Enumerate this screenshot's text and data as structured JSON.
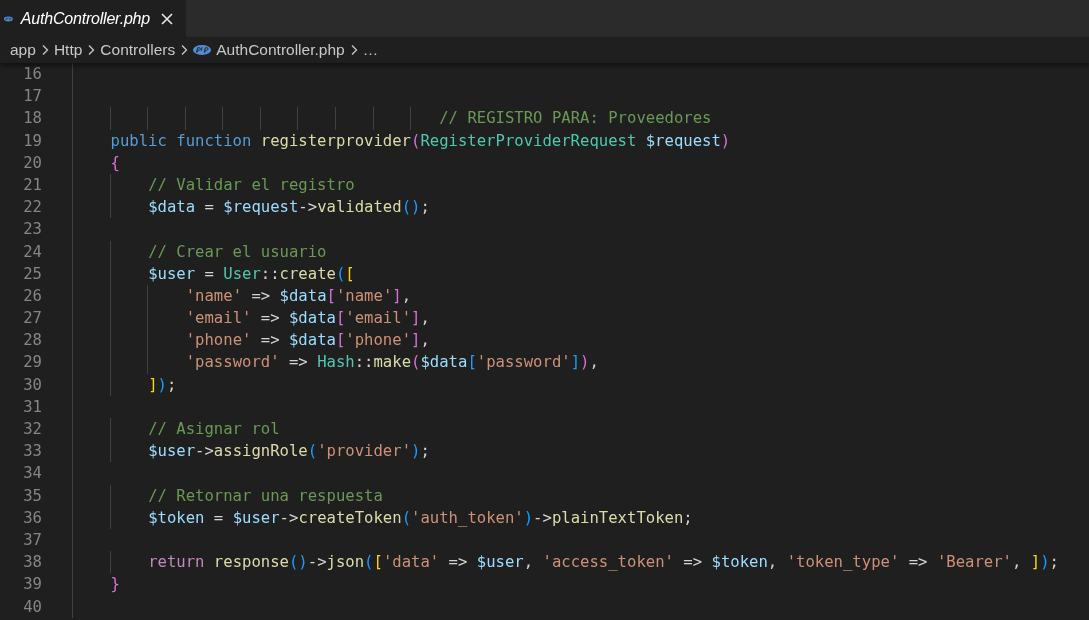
{
  "tab": {
    "label": "AuthController.php",
    "selected": true,
    "preview": true
  },
  "breadcrumb": [
    "app",
    "Http",
    "Controllers",
    "AuthController.php",
    "…"
  ],
  "lines": [
    {
      "number": "16"
    },
    {
      "number": "17"
    },
    {
      "number": "18",
      "tokens": [
        {
          "kind": "cmt",
          "text": "                                       // REGISTRO PARA: Proveedores"
        }
      ]
    },
    {
      "number": "19",
      "tokens": [
        {
          "kind": "kw",
          "text": "    public"
        },
        {
          "kind": "kw",
          "text": " function"
        },
        {
          "kind": "fn",
          "text": " registerprovider"
        },
        {
          "kind": "b2",
          "text": "("
        },
        {
          "kind": "cls",
          "text": "RegisterProviderRequest"
        },
        {
          "kind": "var",
          "text": " $request"
        },
        {
          "kind": "b2",
          "text": ")"
        }
      ]
    },
    {
      "number": "20",
      "tokens": [
        {
          "kind": "b2",
          "text": "    {"
        }
      ]
    },
    {
      "number": "21",
      "tokens": [
        {
          "kind": "cmt",
          "text": "        // Validar el registro"
        }
      ]
    },
    {
      "number": "22",
      "tokens": [
        {
          "kind": "var",
          "text": "        $data"
        },
        {
          "kind": "op",
          "text": " = "
        },
        {
          "kind": "var",
          "text": "$request"
        },
        {
          "kind": "op",
          "text": "->"
        },
        {
          "kind": "fn",
          "text": "validated"
        },
        {
          "kind": "b3",
          "text": "()"
        },
        {
          "kind": "op",
          "text": ";"
        }
      ]
    },
    {
      "number": "23"
    },
    {
      "number": "24",
      "tokens": [
        {
          "kind": "cmt",
          "text": "        // Crear el usuario"
        }
      ]
    },
    {
      "number": "25",
      "tokens": [
        {
          "kind": "var",
          "text": "        $user"
        },
        {
          "kind": "op",
          "text": " = "
        },
        {
          "kind": "cls",
          "text": "User"
        },
        {
          "kind": "op",
          "text": "::"
        },
        {
          "kind": "fn",
          "text": "create"
        },
        {
          "kind": "b3",
          "text": "("
        },
        {
          "kind": "b1",
          "text": "["
        }
      ]
    },
    {
      "number": "26",
      "tokens": [
        {
          "kind": "str",
          "text": "            'name'"
        },
        {
          "kind": "op",
          "text": " => "
        },
        {
          "kind": "var",
          "text": "$data"
        },
        {
          "kind": "b2",
          "text": "["
        },
        {
          "kind": "str",
          "text": "'name'"
        },
        {
          "kind": "b2",
          "text": "]"
        },
        {
          "kind": "op",
          "text": ","
        }
      ]
    },
    {
      "number": "27",
      "tokens": [
        {
          "kind": "str",
          "text": "            'email'"
        },
        {
          "kind": "op",
          "text": " => "
        },
        {
          "kind": "var",
          "text": "$data"
        },
        {
          "kind": "b2",
          "text": "["
        },
        {
          "kind": "str",
          "text": "'email'"
        },
        {
          "kind": "b2",
          "text": "]"
        },
        {
          "kind": "op",
          "text": ","
        }
      ]
    },
    {
      "number": "28",
      "tokens": [
        {
          "kind": "str",
          "text": "            'phone'"
        },
        {
          "kind": "op",
          "text": " => "
        },
        {
          "kind": "var",
          "text": "$data"
        },
        {
          "kind": "b2",
          "text": "["
        },
        {
          "kind": "str",
          "text": "'phone'"
        },
        {
          "kind": "b2",
          "text": "]"
        },
        {
          "kind": "op",
          "text": ","
        }
      ]
    },
    {
      "number": "29",
      "tokens": [
        {
          "kind": "str",
          "text": "            'password'"
        },
        {
          "kind": "op",
          "text": " => "
        },
        {
          "kind": "cls",
          "text": "Hash"
        },
        {
          "kind": "op",
          "text": "::"
        },
        {
          "kind": "fn",
          "text": "make"
        },
        {
          "kind": "b2",
          "text": "("
        },
        {
          "kind": "var",
          "text": "$data"
        },
        {
          "kind": "b3",
          "text": "["
        },
        {
          "kind": "str",
          "text": "'password'"
        },
        {
          "kind": "b3",
          "text": "]"
        },
        {
          "kind": "b2",
          "text": ")"
        },
        {
          "kind": "op",
          "text": ","
        }
      ]
    },
    {
      "number": "30",
      "tokens": [
        {
          "kind": "b1",
          "text": "        ]"
        },
        {
          "kind": "b3",
          "text": ")"
        },
        {
          "kind": "op",
          "text": ";"
        }
      ]
    },
    {
      "number": "31"
    },
    {
      "number": "32",
      "tokens": [
        {
          "kind": "cmt",
          "text": "        // Asignar rol"
        }
      ]
    },
    {
      "number": "33",
      "tokens": [
        {
          "kind": "var",
          "text": "        $user"
        },
        {
          "kind": "op",
          "text": "->"
        },
        {
          "kind": "fn",
          "text": "assignRole"
        },
        {
          "kind": "b3",
          "text": "("
        },
        {
          "kind": "str",
          "text": "'provider'"
        },
        {
          "kind": "b3",
          "text": ")"
        },
        {
          "kind": "op",
          "text": ";"
        }
      ]
    },
    {
      "number": "34"
    },
    {
      "number": "35",
      "tokens": [
        {
          "kind": "cmt",
          "text": "        // Retornar una respuesta"
        }
      ]
    },
    {
      "number": "36",
      "tokens": [
        {
          "kind": "var",
          "text": "        $token"
        },
        {
          "kind": "op",
          "text": " = "
        },
        {
          "kind": "var",
          "text": "$user"
        },
        {
          "kind": "op",
          "text": "->"
        },
        {
          "kind": "fn",
          "text": "createToken"
        },
        {
          "kind": "b3",
          "text": "("
        },
        {
          "kind": "str",
          "text": "'auth_token'"
        },
        {
          "kind": "b3",
          "text": ")"
        },
        {
          "kind": "op",
          "text": "->"
        },
        {
          "kind": "fn",
          "text": "plainTextToken"
        },
        {
          "kind": "op",
          "text": ";"
        }
      ]
    },
    {
      "number": "37"
    },
    {
      "number": "38",
      "tokens": [
        {
          "kind": "ctrl",
          "text": "        return"
        },
        {
          "kind": "fn",
          "text": " response"
        },
        {
          "kind": "b3",
          "text": "()"
        },
        {
          "kind": "op",
          "text": "->"
        },
        {
          "kind": "fn",
          "text": "json"
        },
        {
          "kind": "b3",
          "text": "("
        },
        {
          "kind": "b1",
          "text": "["
        },
        {
          "kind": "str",
          "text": "'data'"
        },
        {
          "kind": "op",
          "text": " => "
        },
        {
          "kind": "var",
          "text": "$user"
        },
        {
          "kind": "op",
          "text": ", "
        },
        {
          "kind": "str",
          "text": "'access_token'"
        },
        {
          "kind": "op",
          "text": " => "
        },
        {
          "kind": "var",
          "text": "$token"
        },
        {
          "kind": "op",
          "text": ", "
        },
        {
          "kind": "str",
          "text": "'token_type'"
        },
        {
          "kind": "op",
          "text": " => "
        },
        {
          "kind": "str",
          "text": "'Bearer'"
        },
        {
          "kind": "op",
          "text": ", "
        },
        {
          "kind": "b1",
          "text": "]"
        },
        {
          "kind": "b3",
          "text": ")"
        },
        {
          "kind": "op",
          "text": ";"
        }
      ]
    },
    {
      "number": "39",
      "tokens": [
        {
          "kind": "b2",
          "text": "    }"
        }
      ]
    },
    {
      "number": "40"
    }
  ]
}
